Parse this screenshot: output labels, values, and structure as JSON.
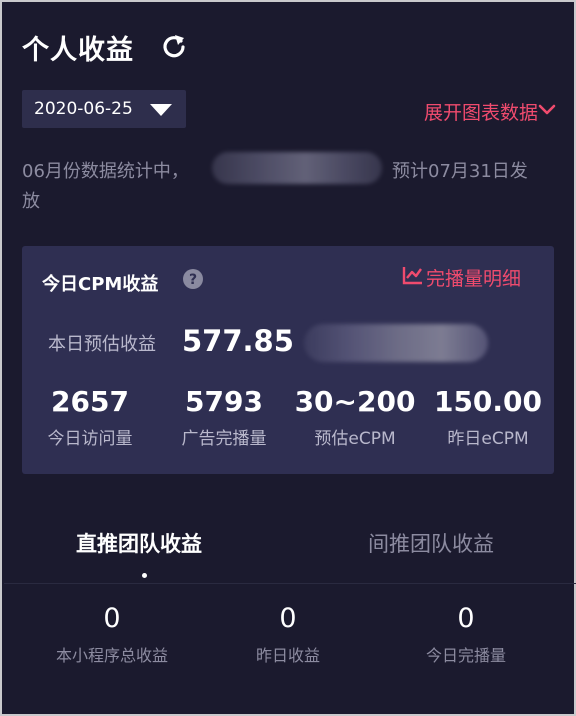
{
  "header": {
    "title": "个人收益",
    "refresh_icon": "refresh-icon"
  },
  "filter": {
    "date": "2020-06-25",
    "expand_label": "展开图表数据"
  },
  "notice": {
    "text_start": "06月份数据统计中，",
    "text_end": "预计07月31日发",
    "text_wrap": "放"
  },
  "cpm_card": {
    "title": "今日CPM收益",
    "detail_label": "完播量明细",
    "estimate_label": "本日预估收益",
    "estimate_value": "577.85",
    "stats": [
      {
        "value": "2657",
        "label": "今日访问量"
      },
      {
        "value": "5793",
        "label": "广告完播量"
      },
      {
        "value": "30~200",
        "label": "预估eCPM"
      },
      {
        "value": "150.00",
        "label": "昨日eCPM"
      }
    ]
  },
  "tabs": [
    {
      "label": "直推团队收益",
      "active": true
    },
    {
      "label": "间推团队收益",
      "active": false
    }
  ],
  "team_stats": [
    {
      "value": "0",
      "label": "本小程序总收益"
    },
    {
      "value": "0",
      "label": "昨日收益"
    },
    {
      "value": "0",
      "label": "今日完播量"
    }
  ],
  "colors": {
    "background": "#1b1a2e",
    "card": "#2f2f52",
    "accent": "#f04b6e",
    "muted_text": "#8c8ba0"
  }
}
